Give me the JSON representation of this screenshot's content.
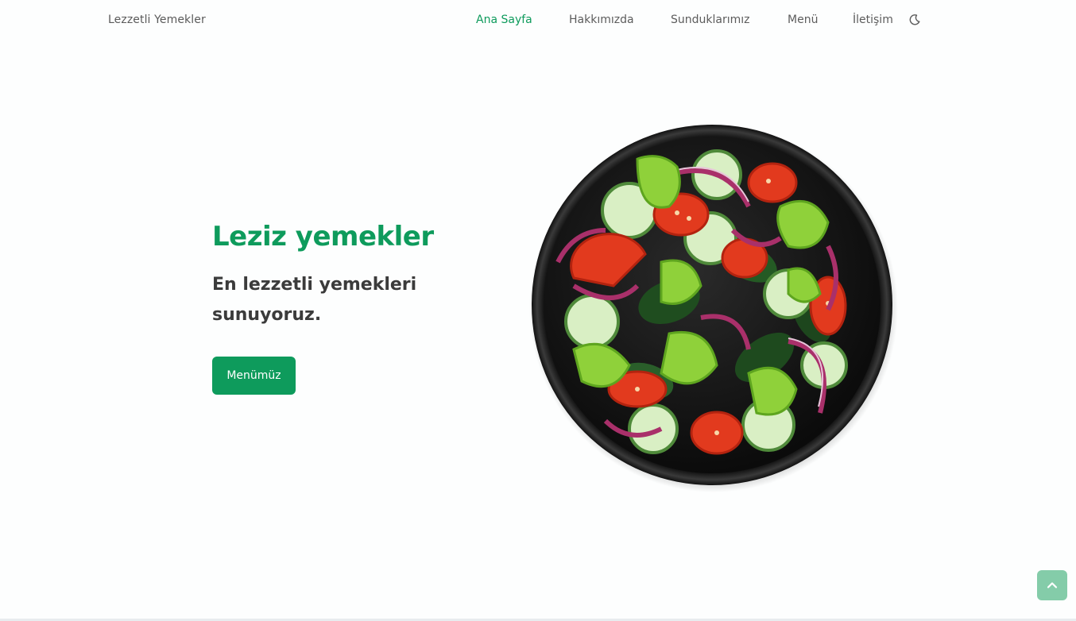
{
  "header": {
    "brand": "Lezzetli Yemekler",
    "nav": [
      {
        "label": "Ana Sayfa",
        "active": true
      },
      {
        "label": "Hakkımızda",
        "active": false
      },
      {
        "label": "Sunduklarımız",
        "active": false
      },
      {
        "label": "Menü",
        "active": false
      },
      {
        "label": "İletişim",
        "active": false
      }
    ],
    "theme_icon": "moon-icon"
  },
  "hero": {
    "title": "Leziz yemekler",
    "subtitle": "En lezzetli yemekleri sunuyoruz.",
    "cta_label": "Menümüz",
    "image": "salad-bowl-image"
  },
  "scroll_top_icon": "chevron-up-icon",
  "colors": {
    "accent": "#0e9b5c",
    "text": "#5c5c5c",
    "heading": "#3b3b3b",
    "scroll_button": "#84cca9"
  }
}
